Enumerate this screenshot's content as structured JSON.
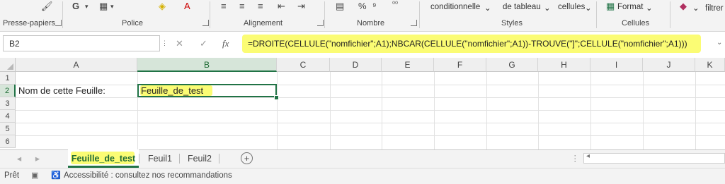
{
  "ribbon": {
    "groups": {
      "clipboard": "Presse-papiers",
      "font": "Police",
      "alignment": "Alignement",
      "number": "Nombre",
      "styles": "Styles",
      "cells": "Cellules"
    },
    "bold": "G",
    "conditional": "conditionnelle",
    "table": "de tableau",
    "cellstyles": "cellules",
    "format": "Format",
    "filter": "filtrer",
    "percent": "%",
    "decimals": "⁰⁰",
    "caret": "⌄"
  },
  "formula_bar": {
    "name_box": "B2",
    "cancel": "✕",
    "enter": "✓",
    "fx": "fx",
    "formula": "=DROITE(CELLULE(\"nomfichier\";A1);NBCAR(CELLULE(\"nomfichier\";A1))-TROUVE(\"]\";CELLULE(\"nomfichier\";A1)))"
  },
  "grid": {
    "columns": [
      "A",
      "B",
      "C",
      "D",
      "E",
      "F",
      "G",
      "H",
      "I",
      "J",
      "K"
    ],
    "rows": [
      "1",
      "2",
      "3",
      "4",
      "5",
      "6"
    ],
    "cells": {
      "A2": "Nom de cette Feuille:",
      "B2": "Feuille_de_test"
    }
  },
  "tabs": {
    "prev": "◂",
    "next": "▸",
    "sheets": [
      "Feuille_de_test",
      "Feuil1",
      "Feuil2"
    ],
    "add": "+",
    "more": "⋮"
  },
  "status": {
    "ready": "Prêt",
    "accessibility": "Accessibilité : consultez nos recommandations"
  },
  "colors": {
    "accent": "#217346",
    "highlight": "#fbfc74"
  }
}
